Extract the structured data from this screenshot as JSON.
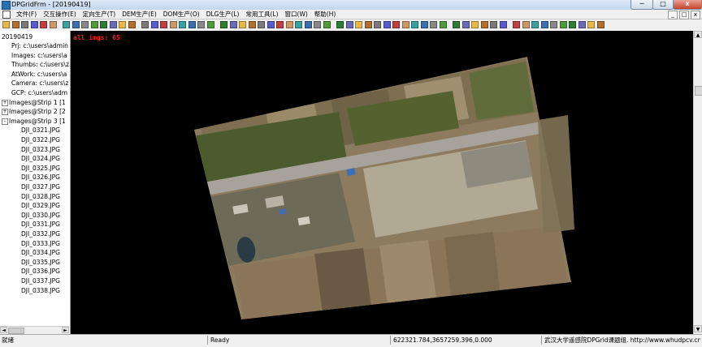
{
  "title_bar": {
    "title": "DPGridFrm - [20190419]",
    "minimize": "─",
    "maximize": "□",
    "close": "x"
  },
  "menu": {
    "items": [
      "文件(F)",
      "交互操作(E)",
      "定向生产(T)",
      "DEM生产(E)",
      "DOM生产(O)",
      "DLG生产(L)",
      "常用工具(L)",
      "窗口(W)",
      "帮助(H)"
    ],
    "mdi_minimize": "_",
    "mdi_restore": "□",
    "mdi_close": "x"
  },
  "sidebar": {
    "root": "20190419",
    "items": [
      {
        "label": "Prj: c:\\users\\admin",
        "expander": ""
      },
      {
        "label": "Images: c:\\users\\a",
        "expander": ""
      },
      {
        "label": "Thumbs: c:\\users\\z",
        "expander": ""
      },
      {
        "label": "AtWork: c:\\users\\a",
        "expander": ""
      },
      {
        "label": "Camera: c:\\users\\z",
        "expander": ""
      },
      {
        "label": "GCP: c:\\users\\adm",
        "expander": ""
      },
      {
        "label": "Images@Strip 1 [1",
        "expander": "+"
      },
      {
        "label": "Images@Strip 2 [2",
        "expander": "+"
      },
      {
        "label": "Images@Strip 3 [1",
        "expander": "-"
      }
    ],
    "files": [
      "DJI_0321.JPG",
      "DJI_0322.JPG",
      "DJI_0323.JPG",
      "DJI_0324.JPG",
      "DJI_0325.JPG",
      "DJI_0326.JPG",
      "DJI_0327.JPG",
      "DJI_0328.JPG",
      "DJI_0329.JPG",
      "DJI_0330.JPG",
      "DJI_0331.JPG",
      "DJI_0332.JPG",
      "DJI_0333.JPG",
      "DJI_0334.JPG",
      "DJI_0335.JPG",
      "DJI_0336.JPG",
      "DJI_0337.JPG",
      "DJI_0338.JPG"
    ]
  },
  "canvas": {
    "overlay": "all imgs: 65"
  },
  "status_bar": {
    "mode": "就绪",
    "state": "Ready",
    "coordinates": "622321.784,3657259.396,0.000",
    "credit": "武汉大学遥感院DPGrid课题组.  http://www.whudpcv.cn"
  },
  "colors": {
    "background": "#000000",
    "overlay_text": "#ff2020",
    "road": "#a7a39b",
    "vegetation": "#4c5b2e",
    "field": "#9b8a6a"
  },
  "icons": {
    "toolbar": [
      "open-icon",
      "save-icon",
      "print-icon",
      "grid-icon",
      "layers-icon",
      "select-icon",
      "zoom-in-icon",
      "zoom-out-icon",
      "pan-icon",
      "measure-icon",
      "edit-icon",
      "line-icon",
      "dem-icon",
      "dom-icon",
      "mosaic-icon",
      "color-icon",
      "tools-icon",
      "help-icon"
    ]
  }
}
